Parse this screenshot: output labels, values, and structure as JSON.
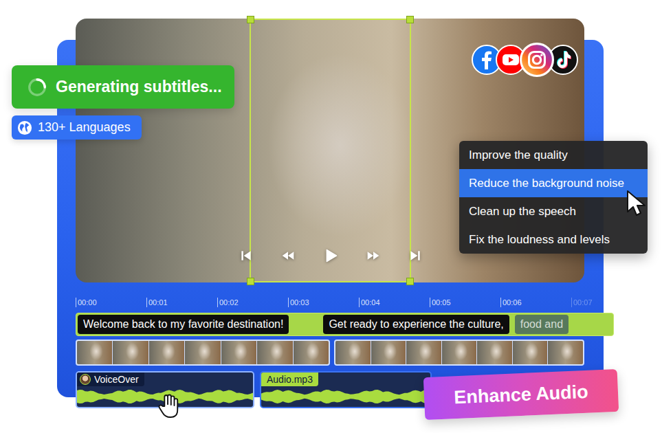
{
  "status_badge": {
    "label": "Generating subtitles..."
  },
  "language_badge": {
    "label": "130+ Languages"
  },
  "menu": {
    "items": [
      {
        "label": "Improve the quality",
        "selected": false
      },
      {
        "label": "Reduce the background noise",
        "selected": true
      },
      {
        "label": "Clean up the speech",
        "selected": false
      },
      {
        "label": "Fix the loudness and levels",
        "selected": false
      }
    ]
  },
  "timeline": {
    "ticks": [
      {
        "label": "00:00",
        "faded": false
      },
      {
        "label": "00:01",
        "faded": false
      },
      {
        "label": "00:02",
        "faded": false
      },
      {
        "label": "00:03",
        "faded": false
      },
      {
        "label": "00:04",
        "faded": false
      },
      {
        "label": "00:05",
        "faded": false
      },
      {
        "label": "00:06",
        "faded": false
      },
      {
        "label": "00:07",
        "faded": true
      }
    ],
    "subtitles": [
      {
        "text": "Welcome back to my favorite destination!",
        "faded": false
      },
      {
        "text": "Get ready to experience the culture,",
        "faded": false
      },
      {
        "text": "food and",
        "faded": true
      }
    ],
    "video_clips": [
      {
        "frames": 7
      },
      {
        "frames": 7
      }
    ],
    "audio_tracks": [
      {
        "label": "VoiceOver",
        "kind": "voiceover"
      },
      {
        "label": "Audio.mp3",
        "kind": "file"
      }
    ]
  },
  "action_button": {
    "label": "Enhance Audio"
  }
}
